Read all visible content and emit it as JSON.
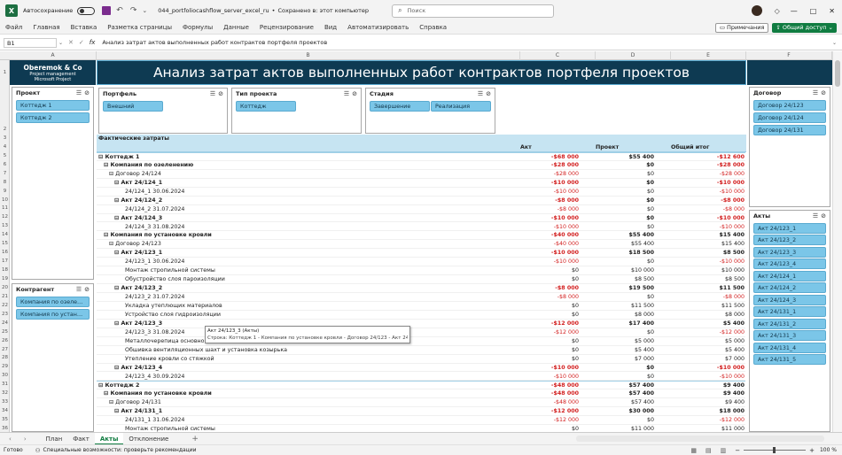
{
  "window": {
    "autosave": "Автосохранение",
    "filename": "044_portfoliocashflow_server_excel_ru",
    "saved": "Сохранено в: этот компьютер",
    "search_placeholder": "Поиск"
  },
  "menu": [
    "Файл",
    "Главная",
    "Вставка",
    "Разметка страницы",
    "Формулы",
    "Данные",
    "Рецензирование",
    "Вид",
    "Автоматизировать",
    "Справка"
  ],
  "ribbon_right": {
    "comments": "Примечания",
    "share": "Общий доступ"
  },
  "formula": {
    "cell": "B1",
    "fx": "fx",
    "content": "Анализ затрат актов выполненных работ контрактов портфеля проектов"
  },
  "columns": [
    "A",
    "B",
    "C",
    "D",
    "E",
    "F"
  ],
  "rows": [
    "1",
    "2",
    "3",
    "4",
    "5",
    "6",
    "7",
    "8",
    "9",
    "10",
    "11",
    "12",
    "13",
    "14",
    "15",
    "16",
    "17",
    "18",
    "19",
    "20",
    "21",
    "22",
    "23",
    "24",
    "25",
    "26",
    "27",
    "28",
    "29",
    "30",
    "31",
    "32",
    "33",
    "34",
    "35",
    "36"
  ],
  "logo": {
    "line1": "Oberemok & Co",
    "line2": "Project management",
    "line3": "Microsoft Project"
  },
  "banner": "Анализ затрат актов выполненных работ контрактов портфеля проектов",
  "slicers": {
    "project": {
      "title": "Проект",
      "items": [
        "Коттедж 1",
        "Коттедж 2"
      ]
    },
    "counterparty": {
      "title": "Контрагент",
      "items": [
        "Компания по озелене...",
        "Компания по установ..."
      ]
    },
    "portfolio": {
      "title": "Портфель",
      "items": [
        "Внешний"
      ]
    },
    "project_type": {
      "title": "Тип проекта",
      "items": [
        "Коттедж"
      ]
    },
    "stage": {
      "title": "Стадия",
      "items": [
        "Завершение",
        "Реализация"
      ]
    },
    "contract": {
      "title": "Договор",
      "items": [
        "Договор 24/123",
        "Договор 24/124",
        "Договор 24/131"
      ]
    },
    "acts": {
      "title": "Акты",
      "items": [
        "Акт 24/123_1",
        "Акт 24/123_2",
        "Акт 24/123_3",
        "Акт 24/123_4",
        "Акт 24/124_1",
        "Акт 24/124_2",
        "Акт 24/124_3",
        "Акт 24/131_1",
        "Акт 24/131_2",
        "Акт 24/131_3",
        "Акт 24/131_4",
        "Акт 24/131_5"
      ]
    }
  },
  "pivot": {
    "caption": "Фактические затраты",
    "headers": [
      "Акт",
      "Проект",
      "Общий итог"
    ],
    "rows": [
      {
        "t": "⊟ Коттедж 1",
        "l": 0,
        "b": true,
        "a": "-$68 000",
        "p": "$55 400",
        "g": "-$12 600"
      },
      {
        "t": "⊟ Компания по озеленению",
        "l": 1,
        "b": true,
        "a": "-$28 000",
        "p": "$0",
        "g": "-$28 000"
      },
      {
        "t": "⊟ Договор 24/124",
        "l": 2,
        "b": false,
        "a": "-$28 000",
        "p": "$0",
        "g": "-$28 000"
      },
      {
        "t": "⊟ Акт 24/124_1",
        "l": 3,
        "b": true,
        "a": "-$10 000",
        "p": "$0",
        "g": "-$10 000"
      },
      {
        "t": "24/124_1 30.06.2024",
        "l": 4,
        "b": false,
        "a": "-$10 000",
        "p": "$0",
        "g": "-$10 000"
      },
      {
        "t": "⊟ Акт 24/124_2",
        "l": 3,
        "b": true,
        "a": "-$8 000",
        "p": "$0",
        "g": "-$8 000"
      },
      {
        "t": "24/124_2 31.07.2024",
        "l": 4,
        "b": false,
        "a": "-$8 000",
        "p": "$0",
        "g": "-$8 000"
      },
      {
        "t": "⊟ Акт 24/124_3",
        "l": 3,
        "b": true,
        "a": "-$10 000",
        "p": "$0",
        "g": "-$10 000"
      },
      {
        "t": "24/124_3 31.08.2024",
        "l": 4,
        "b": false,
        "a": "-$10 000",
        "p": "$0",
        "g": "-$10 000"
      },
      {
        "t": "⊟ Компания по установке кровли",
        "l": 1,
        "b": true,
        "a": "-$40 000",
        "p": "$55 400",
        "g": "$15 400"
      },
      {
        "t": "⊟ Договор 24/123",
        "l": 2,
        "b": false,
        "a": "-$40 000",
        "p": "$55 400",
        "g": "$15 400"
      },
      {
        "t": "⊟ Акт 24/123_1",
        "l": 3,
        "b": true,
        "a": "-$10 000",
        "p": "$18 500",
        "g": "$8 500"
      },
      {
        "t": "24/123_1 30.06.2024",
        "l": 4,
        "b": false,
        "a": "-$10 000",
        "p": "$0",
        "g": "-$10 000"
      },
      {
        "t": "Монтаж стропильной системы",
        "l": 4,
        "b": false,
        "a": "$0",
        "p": "$10 000",
        "g": "$10 000"
      },
      {
        "t": "Обустройство слоя пароизоляции",
        "l": 4,
        "b": false,
        "a": "$0",
        "p": "$8 500",
        "g": "$8 500"
      },
      {
        "t": "⊟ Акт 24/123_2",
        "l": 3,
        "b": true,
        "a": "-$8 000",
        "p": "$19 500",
        "g": "$11 500"
      },
      {
        "t": "24/123_2 31.07.2024",
        "l": 4,
        "b": false,
        "a": "-$8 000",
        "p": "$0",
        "g": "-$8 000"
      },
      {
        "t": "Укладка утеплющих материалов",
        "l": 4,
        "b": false,
        "a": "$0",
        "p": "$11 500",
        "g": "$11 500"
      },
      {
        "t": "Устройство слоя гидроизоляции",
        "l": 4,
        "b": false,
        "a": "$0",
        "p": "$8 000",
        "g": "$8 000"
      },
      {
        "t": "⊟ Акт 24/123_3",
        "l": 3,
        "b": true,
        "a": "-$12 000",
        "p": "$17 400",
        "g": "$5 400"
      },
      {
        "t": "24/123_3 31.08.2024",
        "l": 4,
        "b": false,
        "a": "-$12 000",
        "p": "$0",
        "g": "-$12 000"
      },
      {
        "t": "Металлочерепица основной",
        "l": 4,
        "b": false,
        "a": "$0",
        "p": "$5 000",
        "g": "$5 000"
      },
      {
        "t": "Обшивка вентиляционных шахт и установка козырька",
        "l": 4,
        "b": false,
        "a": "$0",
        "p": "$5 400",
        "g": "$5 400"
      },
      {
        "t": "Утепление кровли со стяжкой",
        "l": 4,
        "b": false,
        "a": "$0",
        "p": "$7 000",
        "g": "$7 000"
      },
      {
        "t": "⊟ Акт 24/123_4",
        "l": 3,
        "b": true,
        "a": "-$10 000",
        "p": "$0",
        "g": "-$10 000"
      },
      {
        "t": "24/123_4 30.09.2024",
        "l": 4,
        "b": false,
        "a": "-$10 000",
        "p": "$0",
        "g": "-$10 000"
      },
      {
        "t": "⊟ Коттедж 2",
        "l": 0,
        "b": true,
        "a": "-$48 000",
        "p": "$57 400",
        "g": "$9 400"
      },
      {
        "t": "⊟ Компания по установке кровли",
        "l": 1,
        "b": true,
        "a": "-$48 000",
        "p": "$57 400",
        "g": "$9 400"
      },
      {
        "t": "⊟ Договор 24/131",
        "l": 2,
        "b": false,
        "a": "-$48 000",
        "p": "$57 400",
        "g": "$9 400"
      },
      {
        "t": "⊟ Акт 24/131_1",
        "l": 3,
        "b": true,
        "a": "-$12 000",
        "p": "$30 000",
        "g": "$18 000"
      },
      {
        "t": "24/131_1 31.06.2024",
        "l": 4,
        "b": false,
        "a": "-$12 000",
        "p": "$0",
        "g": "-$12 000"
      },
      {
        "t": "Монтаж стропильной системы",
        "l": 4,
        "b": false,
        "a": "$0",
        "p": "$11 000",
        "g": "$11 000"
      }
    ]
  },
  "tooltip": {
    "line1": "Акт 24/123_3 (Акты)",
    "line2": "Строка: Коттедж 1 - Компания по установке кровли - Договор 24/123 - Акт 24/123_3"
  },
  "tabs": [
    "План",
    "Факт",
    "Акты",
    "Отклонение"
  ],
  "active_tab": "Акты",
  "status": {
    "ready": "Готово",
    "accessibility": "Специальные возможности: проверьте рекомендации",
    "zoom": "100 %"
  }
}
